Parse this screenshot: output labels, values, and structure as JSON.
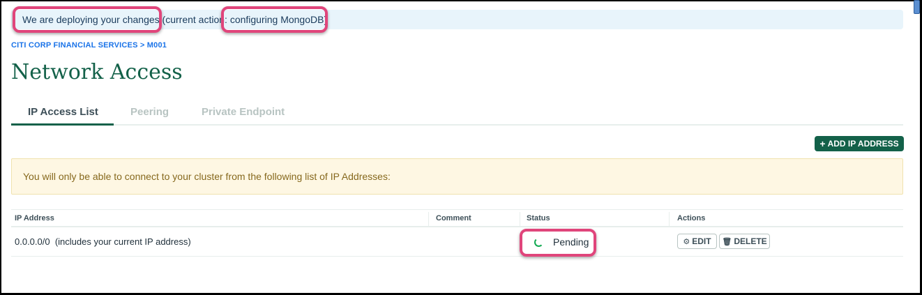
{
  "deploy_banner": {
    "part1": "We are deploying your changes",
    "part2": " (current action: ",
    "part3": "configuring MongoDB",
    "part4": ")"
  },
  "breadcrumb": "CITI CORP FINANCIAL SERVICES > M001",
  "page_title": "Network Access",
  "tabs": [
    {
      "label": "IP Access List",
      "active": true
    },
    {
      "label": "Peering",
      "active": false
    },
    {
      "label": "Private Endpoint",
      "active": false
    }
  ],
  "add_button": {
    "icon": "plus-icon",
    "label": "ADD IP ADDRESS"
  },
  "warning_text": "You will only be able to connect to your cluster from the following list of IP Addresses:",
  "table": {
    "headers": [
      "IP Address",
      "Comment",
      "Status",
      "Actions"
    ],
    "rows": [
      {
        "ip": "0.0.0.0/0  (includes your current IP address)",
        "comment": "",
        "status": "Pending",
        "status_icon": "spinner-icon",
        "actions": [
          {
            "icon": "gear-icon",
            "label": "EDIT"
          },
          {
            "icon": "trash-icon",
            "label": "DELETE"
          }
        ]
      }
    ]
  },
  "colors": {
    "brand_green": "#136149",
    "link_blue": "#1a73e8",
    "highlight_pink": "#e0457b",
    "banner_bg": "#e8f4fb",
    "warning_bg": "#fef7e3",
    "warning_text": "#86681d"
  }
}
